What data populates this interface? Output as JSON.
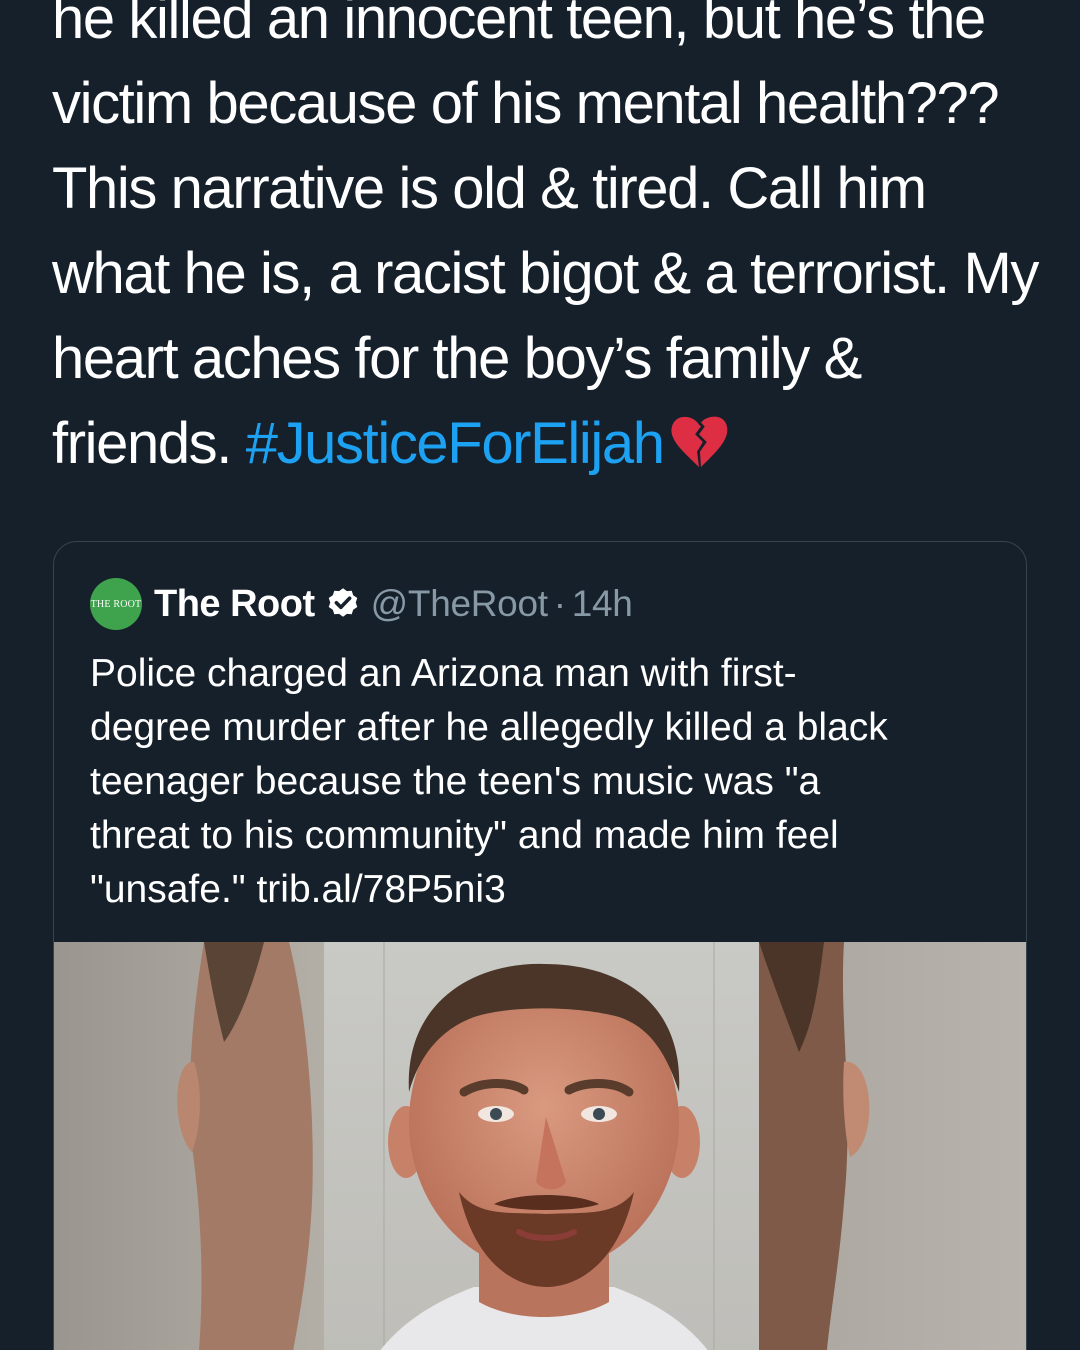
{
  "tweet": {
    "lines": [
      "he killed an innocent teen, but he’s the",
      "victim because of his mental health???",
      "This narrative is old & tired. Call him",
      "what he is, a racist bigot & a terrorist. My",
      "heart aches for the boy’s family &"
    ],
    "last_line_prefix": "friends. ",
    "hashtag": "#JusticeForElijah",
    "emoji_icon": "broken-heart-icon"
  },
  "quoted_tweet": {
    "avatar_text": "THE ROOT",
    "display_name": "The Root",
    "verified_icon": "verified-badge-icon",
    "handle": "@TheRoot",
    "separator": "·",
    "time": "14h",
    "text_lines": [
      "Police charged an Arizona man with first-",
      "degree murder after he allegedly killed a black",
      "teenager because the teen's music was \"a",
      "threat to his community\" and made him feel",
      "\"unsafe.\"  trib.al/78P5ni3"
    ],
    "photo": "mugshot-photo"
  },
  "colors": {
    "background": "#15202b",
    "text": "#ffffff",
    "hashtag": "#1da1f2",
    "secondary": "#8899a6",
    "card_border": "#38444d",
    "avatar": "#3fa34d"
  }
}
